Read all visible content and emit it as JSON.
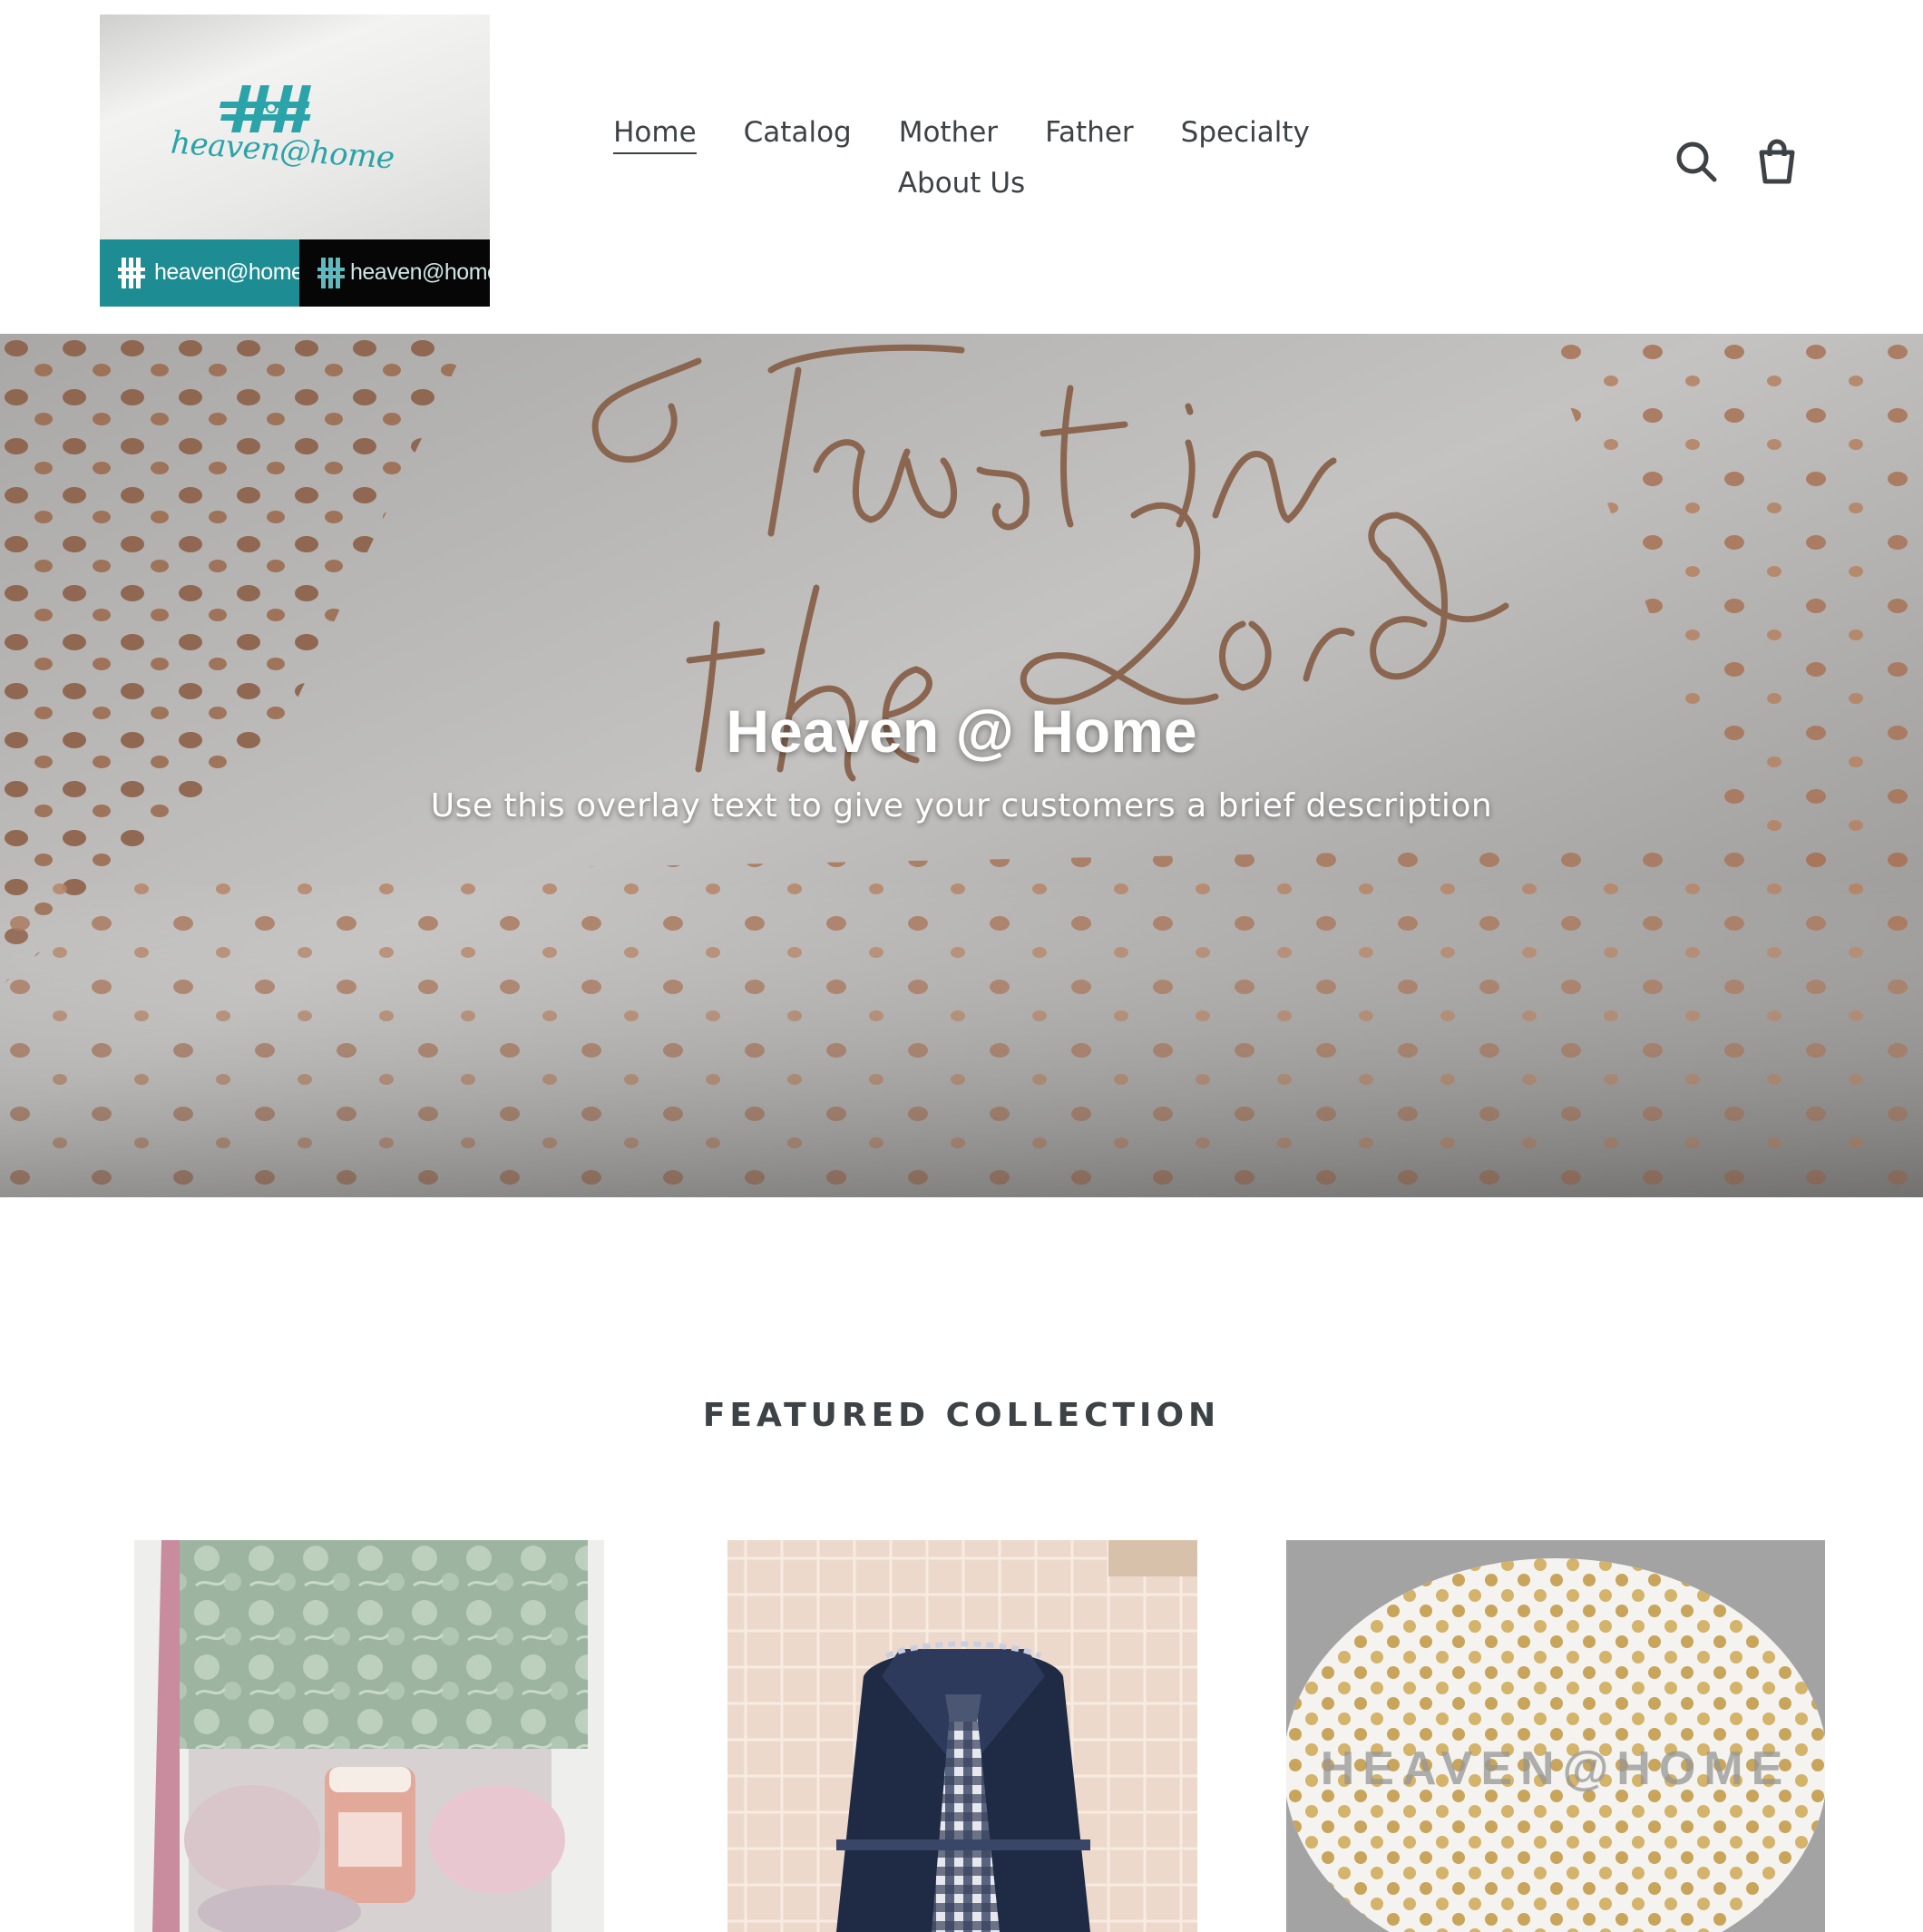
{
  "header": {
    "logo_brand": "heaven@home",
    "logo_strip_left": "heaven@home",
    "logo_strip_right": "heaven@home",
    "nav": [
      {
        "label": "Home",
        "active": true
      },
      {
        "label": "Catalog",
        "active": false
      },
      {
        "label": "Mother",
        "active": false
      },
      {
        "label": "Father",
        "active": false
      },
      {
        "label": "Specialty",
        "active": false
      },
      {
        "label": "About Us",
        "active": false
      }
    ],
    "icons": [
      "search-icon",
      "cart-icon"
    ]
  },
  "hero": {
    "image_script_text": "Trust in the Lord",
    "title": "Heaven @ Home",
    "subtitle": "Use this overlay text to give your customers a brief description"
  },
  "featured": {
    "title": "FEATURED COLLECTION",
    "products": [
      {
        "image": "floral gift box with candle and towels"
      },
      {
        "image": "navy towel folded like a shirt with gingham tie"
      },
      {
        "image": "white gift box lid with gold dots",
        "watermark": "HEAVEN@HOME"
      }
    ]
  },
  "colors": {
    "text": "#3d4246",
    "logo_teal": "#1e8c93",
    "logo_black": "#060606",
    "hero_copper": "#9a6a4c"
  }
}
